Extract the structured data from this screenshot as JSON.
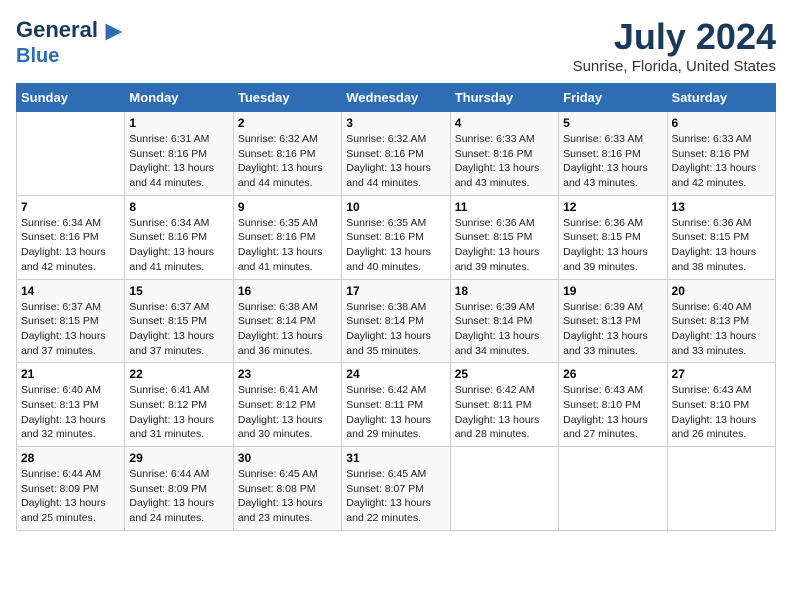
{
  "logo": {
    "line1": "General",
    "line2": "Blue"
  },
  "title": "July 2024",
  "subtitle": "Sunrise, Florida, United States",
  "columns": [
    "Sunday",
    "Monday",
    "Tuesday",
    "Wednesday",
    "Thursday",
    "Friday",
    "Saturday"
  ],
  "weeks": [
    [
      {
        "day": "",
        "info": ""
      },
      {
        "day": "1",
        "info": "Sunrise: 6:31 AM\nSunset: 8:16 PM\nDaylight: 13 hours\nand 44 minutes."
      },
      {
        "day": "2",
        "info": "Sunrise: 6:32 AM\nSunset: 8:16 PM\nDaylight: 13 hours\nand 44 minutes."
      },
      {
        "day": "3",
        "info": "Sunrise: 6:32 AM\nSunset: 8:16 PM\nDaylight: 13 hours\nand 44 minutes."
      },
      {
        "day": "4",
        "info": "Sunrise: 6:33 AM\nSunset: 8:16 PM\nDaylight: 13 hours\nand 43 minutes."
      },
      {
        "day": "5",
        "info": "Sunrise: 6:33 AM\nSunset: 8:16 PM\nDaylight: 13 hours\nand 43 minutes."
      },
      {
        "day": "6",
        "info": "Sunrise: 6:33 AM\nSunset: 8:16 PM\nDaylight: 13 hours\nand 42 minutes."
      }
    ],
    [
      {
        "day": "7",
        "info": "Sunrise: 6:34 AM\nSunset: 8:16 PM\nDaylight: 13 hours\nand 42 minutes."
      },
      {
        "day": "8",
        "info": "Sunrise: 6:34 AM\nSunset: 8:16 PM\nDaylight: 13 hours\nand 41 minutes."
      },
      {
        "day": "9",
        "info": "Sunrise: 6:35 AM\nSunset: 8:16 PM\nDaylight: 13 hours\nand 41 minutes."
      },
      {
        "day": "10",
        "info": "Sunrise: 6:35 AM\nSunset: 8:16 PM\nDaylight: 13 hours\nand 40 minutes."
      },
      {
        "day": "11",
        "info": "Sunrise: 6:36 AM\nSunset: 8:15 PM\nDaylight: 13 hours\nand 39 minutes."
      },
      {
        "day": "12",
        "info": "Sunrise: 6:36 AM\nSunset: 8:15 PM\nDaylight: 13 hours\nand 39 minutes."
      },
      {
        "day": "13",
        "info": "Sunrise: 6:36 AM\nSunset: 8:15 PM\nDaylight: 13 hours\nand 38 minutes."
      }
    ],
    [
      {
        "day": "14",
        "info": "Sunrise: 6:37 AM\nSunset: 8:15 PM\nDaylight: 13 hours\nand 37 minutes."
      },
      {
        "day": "15",
        "info": "Sunrise: 6:37 AM\nSunset: 8:15 PM\nDaylight: 13 hours\nand 37 minutes."
      },
      {
        "day": "16",
        "info": "Sunrise: 6:38 AM\nSunset: 8:14 PM\nDaylight: 13 hours\nand 36 minutes."
      },
      {
        "day": "17",
        "info": "Sunrise: 6:38 AM\nSunset: 8:14 PM\nDaylight: 13 hours\nand 35 minutes."
      },
      {
        "day": "18",
        "info": "Sunrise: 6:39 AM\nSunset: 8:14 PM\nDaylight: 13 hours\nand 34 minutes."
      },
      {
        "day": "19",
        "info": "Sunrise: 6:39 AM\nSunset: 8:13 PM\nDaylight: 13 hours\nand 33 minutes."
      },
      {
        "day": "20",
        "info": "Sunrise: 6:40 AM\nSunset: 8:13 PM\nDaylight: 13 hours\nand 33 minutes."
      }
    ],
    [
      {
        "day": "21",
        "info": "Sunrise: 6:40 AM\nSunset: 8:13 PM\nDaylight: 13 hours\nand 32 minutes."
      },
      {
        "day": "22",
        "info": "Sunrise: 6:41 AM\nSunset: 8:12 PM\nDaylight: 13 hours\nand 31 minutes."
      },
      {
        "day": "23",
        "info": "Sunrise: 6:41 AM\nSunset: 8:12 PM\nDaylight: 13 hours\nand 30 minutes."
      },
      {
        "day": "24",
        "info": "Sunrise: 6:42 AM\nSunset: 8:11 PM\nDaylight: 13 hours\nand 29 minutes."
      },
      {
        "day": "25",
        "info": "Sunrise: 6:42 AM\nSunset: 8:11 PM\nDaylight: 13 hours\nand 28 minutes."
      },
      {
        "day": "26",
        "info": "Sunrise: 6:43 AM\nSunset: 8:10 PM\nDaylight: 13 hours\nand 27 minutes."
      },
      {
        "day": "27",
        "info": "Sunrise: 6:43 AM\nSunset: 8:10 PM\nDaylight: 13 hours\nand 26 minutes."
      }
    ],
    [
      {
        "day": "28",
        "info": "Sunrise: 6:44 AM\nSunset: 8:09 PM\nDaylight: 13 hours\nand 25 minutes."
      },
      {
        "day": "29",
        "info": "Sunrise: 6:44 AM\nSunset: 8:09 PM\nDaylight: 13 hours\nand 24 minutes."
      },
      {
        "day": "30",
        "info": "Sunrise: 6:45 AM\nSunset: 8:08 PM\nDaylight: 13 hours\nand 23 minutes."
      },
      {
        "day": "31",
        "info": "Sunrise: 6:45 AM\nSunset: 8:07 PM\nDaylight: 13 hours\nand 22 minutes."
      },
      {
        "day": "",
        "info": ""
      },
      {
        "day": "",
        "info": ""
      },
      {
        "day": "",
        "info": ""
      }
    ]
  ]
}
